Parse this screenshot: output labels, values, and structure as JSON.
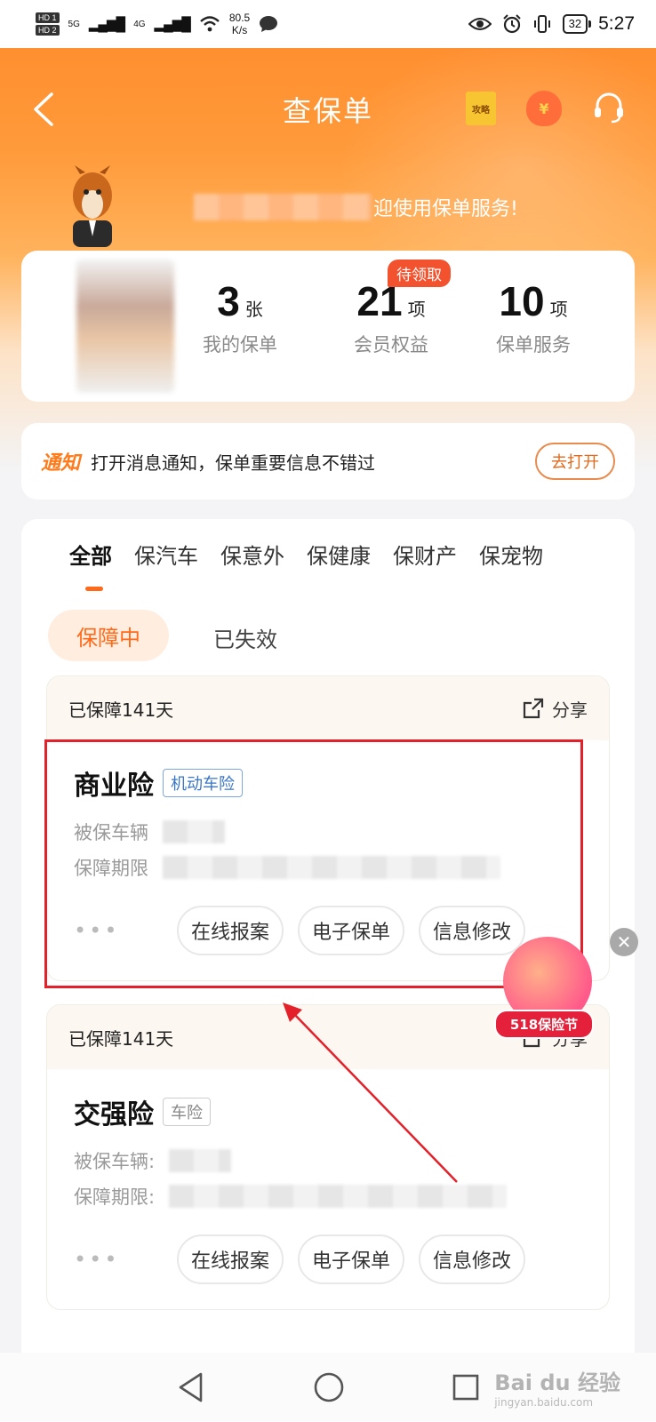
{
  "status_bar": {
    "hd1": "HD 1",
    "hd2": "HD 2",
    "net1": "5G",
    "net2": "4G",
    "speed_value": "80.5",
    "speed_unit": "K/s",
    "battery": "32",
    "time": "5:27"
  },
  "header": {
    "title": "查保单",
    "guide_icon_label": "攻略"
  },
  "welcome": {
    "text": "迎使用保单服务!"
  },
  "summary": {
    "pending_badge": "待领取",
    "stats": [
      {
        "num": "3",
        "unit": "张",
        "label": "我的保单"
      },
      {
        "num": "21",
        "unit": "项",
        "label": "会员权益"
      },
      {
        "num": "10",
        "unit": "项",
        "label": "保单服务"
      }
    ]
  },
  "notice": {
    "tag": "通知",
    "text": "打开消息通知，保单重要信息不错过",
    "button": "去打开"
  },
  "tabs": [
    "全部",
    "保汽车",
    "保意外",
    "保健康",
    "保财产",
    "保宠物"
  ],
  "filters": {
    "active": "保障中",
    "inactive": "已失效"
  },
  "policies": [
    {
      "days": "已保障141天",
      "share": "分享",
      "name": "商业险",
      "tag": "机动车险",
      "vehicle_label": "被保车辆",
      "period_label": "保障期限",
      "actions": [
        "在线报案",
        "电子保单",
        "信息修改"
      ]
    },
    {
      "days": "已保障141天",
      "share": "分享",
      "name": "交强险",
      "tag": "车险",
      "vehicle_label": "被保车辆:",
      "period_label": "保障期限:",
      "actions": [
        "在线报案",
        "电子保单",
        "信息修改"
      ]
    }
  ],
  "promo": {
    "label": "518保险节"
  },
  "watermark": {
    "brand": "Bai du 经验",
    "sub": "jingyan.baidu.com"
  },
  "colors": {
    "brand_orange": "#ff7a1a",
    "highlight_red": "#e3212a",
    "tag_blue": "#3a76c6"
  }
}
